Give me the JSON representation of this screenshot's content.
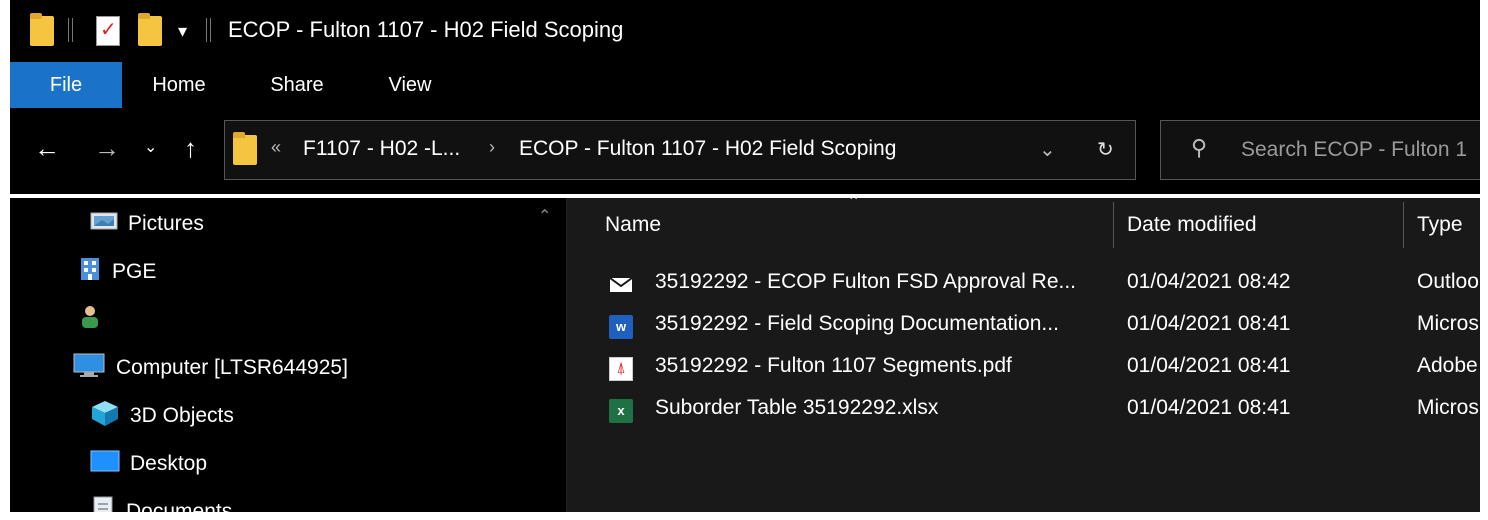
{
  "window": {
    "title": "ECOP - Fulton 1107 - H02 Field Scoping",
    "quick_access_dropdown": "▾"
  },
  "ribbon": {
    "tabs": [
      {
        "label": "File"
      },
      {
        "label": "Home"
      },
      {
        "label": "Share"
      },
      {
        "label": "View"
      }
    ]
  },
  "address": {
    "overflow": "«",
    "crumbs": [
      "F1107 - H02 -L...",
      "ECOP - Fulton 1107 - H02 Field Scoping"
    ],
    "separator": "›"
  },
  "search": {
    "placeholder": "Search ECOP - Fulton 1"
  },
  "nav_pane": {
    "items": [
      {
        "label": "Pictures",
        "icon": "pictures-icon"
      },
      {
        "label": "PGE",
        "icon": "building-icon"
      },
      {
        "label": "",
        "icon": "user-icon",
        "redacted": true
      },
      {
        "label": "Computer [LTSR644925]",
        "icon": "computer-icon"
      },
      {
        "label": "3D Objects",
        "icon": "cube-icon"
      },
      {
        "label": "Desktop",
        "icon": "desktop-icon"
      },
      {
        "label": "Documents",
        "icon": "documents-icon"
      }
    ]
  },
  "file_list": {
    "columns": {
      "name": "Name",
      "date": "Date modified",
      "type": "Type"
    },
    "rows": [
      {
        "name": "35192292 - ECOP Fulton FSD Approval Re...",
        "date": "01/04/2021 08:42",
        "type": "Outloo",
        "icon": "mail-icon"
      },
      {
        "name": "35192292 - Field Scoping Documentation...",
        "date": "01/04/2021 08:41",
        "type": "Micros",
        "icon": "word-icon"
      },
      {
        "name": "35192292 - Fulton 1107 Segments.pdf",
        "date": "01/04/2021 08:41",
        "type": "Adobe",
        "icon": "pdf-icon"
      },
      {
        "name": "Suborder Table 35192292.xlsx",
        "date": "01/04/2021 08:41",
        "type": "Micros",
        "icon": "excel-icon"
      }
    ]
  },
  "colors": {
    "file_tab": "#1a73c8",
    "background": "#000000",
    "content_background": "#191919",
    "folder": "#f5c542"
  }
}
